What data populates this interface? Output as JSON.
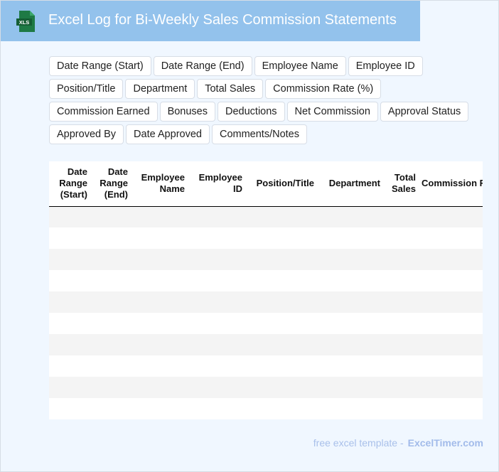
{
  "header": {
    "title": "Excel Log for Bi-Weekly Sales Commission Statements",
    "icon_label": "XLS",
    "icon_color": "#1e7a45",
    "bg_color": "#93c2ec"
  },
  "tags": [
    "Date Range (Start)",
    "Date Range (End)",
    "Employee Name",
    "Employee ID",
    "Position/Title",
    "Department",
    "Total Sales",
    "Commission Rate (%)",
    "Commission Earned",
    "Bonuses",
    "Deductions",
    "Net Commission",
    "Approval Status",
    "Approved By",
    "Date Approved",
    "Comments/Notes"
  ],
  "table": {
    "columns": [
      "Date Range (Start)",
      "Date Range (End)",
      "Employee Name",
      "Employee ID",
      "Position/Title",
      "Department",
      "Total Sales",
      "Commission Rate (%)"
    ],
    "row_count": 10
  },
  "footer": {
    "text": "free excel template -",
    "brand": "ExcelTimer.com"
  }
}
